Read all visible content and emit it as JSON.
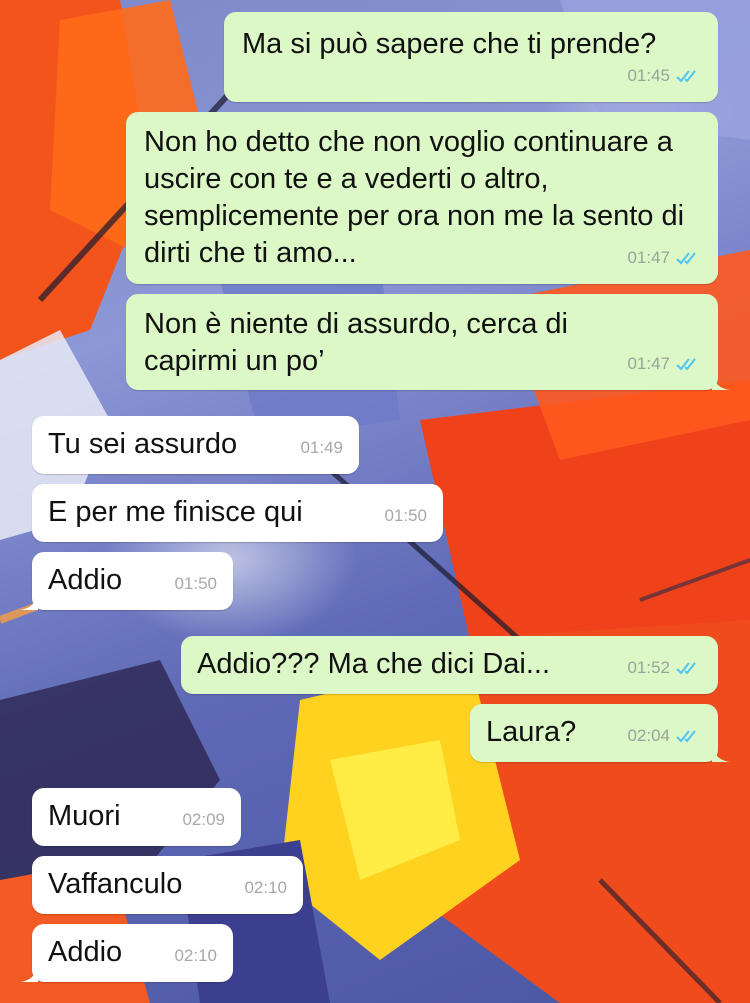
{
  "colors": {
    "outgoing_bubble": "#dcf8c6",
    "incoming_bubble": "#ffffff",
    "read_ticks": "#4fc3f7",
    "timestamp": "#98a49a"
  },
  "icons": {
    "read_status": "double-check-icon"
  },
  "messages": [
    {
      "direction": "outgoing",
      "text": "Ma si può sapere che ti prende?",
      "time": "01:45",
      "status": "read"
    },
    {
      "direction": "outgoing",
      "text": "Non ho detto che non voglio continuare a uscire con te e a vederti o altro, semplicemente per ora non me la sento di dirti che ti amo...",
      "time": "01:47",
      "status": "read"
    },
    {
      "direction": "outgoing",
      "text": "Non è niente di assurdo, cerca di capirmi un po’",
      "time": "01:47",
      "status": "read"
    },
    {
      "direction": "incoming",
      "text": "Tu sei assurdo",
      "time": "01:49"
    },
    {
      "direction": "incoming",
      "text": "E per me finisce qui",
      "time": "01:50"
    },
    {
      "direction": "incoming",
      "text": "Addio",
      "time": "01:50"
    },
    {
      "direction": "outgoing",
      "text": "Addio??? Ma che dici Dai...",
      "time": "01:52",
      "status": "read"
    },
    {
      "direction": "outgoing",
      "text": "Laura?",
      "time": "02:04",
      "status": "read"
    },
    {
      "direction": "incoming",
      "text": "Muori",
      "time": "02:09"
    },
    {
      "direction": "incoming",
      "text": "Vaffanculo",
      "time": "02:10"
    },
    {
      "direction": "incoming",
      "text": "Addio",
      "time": "02:10"
    }
  ]
}
